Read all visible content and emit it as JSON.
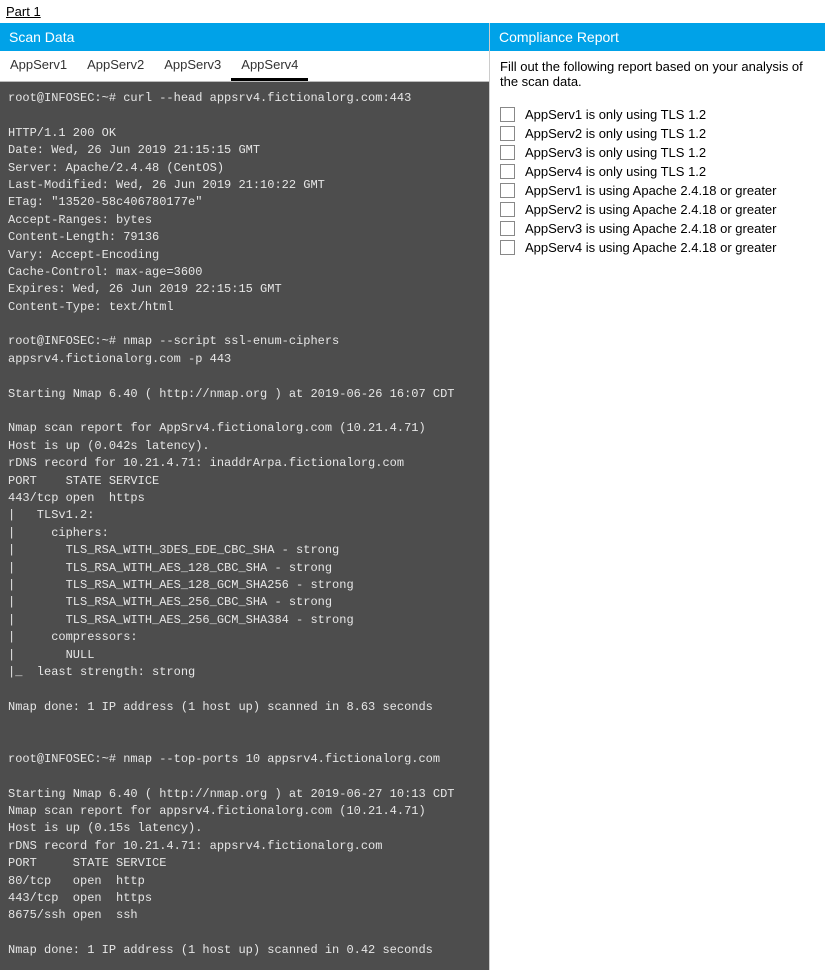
{
  "part_link": "Part 1",
  "left": {
    "header": "Scan Data",
    "tabs": [
      "AppServ1",
      "AppServ2",
      "AppServ3",
      "AppServ4"
    ],
    "active_tab_index": 3,
    "terminal": "root@INFOSEC:~# curl --head appsrv4.fictionalorg.com:443\n\nHTTP/1.1 200 OK\nDate: Wed, 26 Jun 2019 21:15:15 GMT\nServer: Apache/2.4.48 (CentOS)\nLast-Modified: Wed, 26 Jun 2019 21:10:22 GMT\nETag: \"13520-58c406780177e\"\nAccept-Ranges: bytes\nContent-Length: 79136\nVary: Accept-Encoding\nCache-Control: max-age=3600\nExpires: Wed, 26 Jun 2019 22:15:15 GMT\nContent-Type: text/html\n\nroot@INFOSEC:~# nmap --script ssl-enum-ciphers appsrv4.fictionalorg.com -p 443\n\nStarting Nmap 6.40 ( http://nmap.org ) at 2019-06-26 16:07 CDT\n\nNmap scan report for AppSrv4.fictionalorg.com (10.21.4.71)\nHost is up (0.042s latency).\nrDNS record for 10.21.4.71: inaddrArpa.fictionalorg.com\nPORT    STATE SERVICE\n443/tcp open  https\n|   TLSv1.2:\n|     ciphers:\n|       TLS_RSA_WITH_3DES_EDE_CBC_SHA - strong\n|       TLS_RSA_WITH_AES_128_CBC_SHA - strong\n|       TLS_RSA_WITH_AES_128_GCM_SHA256 - strong\n|       TLS_RSA_WITH_AES_256_CBC_SHA - strong\n|       TLS_RSA_WITH_AES_256_GCM_SHA384 - strong\n|     compressors:\n|       NULL\n|_  least strength: strong\n\nNmap done: 1 IP address (1 host up) scanned in 8.63 seconds\n\n\nroot@INFOSEC:~# nmap --top-ports 10 appsrv4.fictionalorg.com\n\nStarting Nmap 6.40 ( http://nmap.org ) at 2019-06-27 10:13 CDT\nNmap scan report for appsrv4.fictionalorg.com (10.21.4.71)\nHost is up (0.15s latency).\nrDNS record for 10.21.4.71: appsrv4.fictionalorg.com\nPORT     STATE SERVICE\n80/tcp   open  http\n443/tcp  open  https\n8675/ssh open  ssh\n\nNmap done: 1 IP address (1 host up) scanned in 0.42 seconds"
  },
  "right": {
    "header": "Compliance Report",
    "instructions": "Fill out the following report based on your analysis of the scan data.",
    "items": [
      "AppServ1 is only using TLS 1.2",
      "AppServ2 is only using TLS 1.2",
      "AppServ3 is only using TLS 1.2",
      "AppServ4 is only using TLS 1.2",
      "AppServ1 is using Apache 2.4.18 or greater",
      "AppServ2 is using Apache 2.4.18 or greater",
      "AppServ3 is using Apache 2.4.18 or greater",
      "AppServ4 is using Apache 2.4.18 or greater"
    ]
  }
}
